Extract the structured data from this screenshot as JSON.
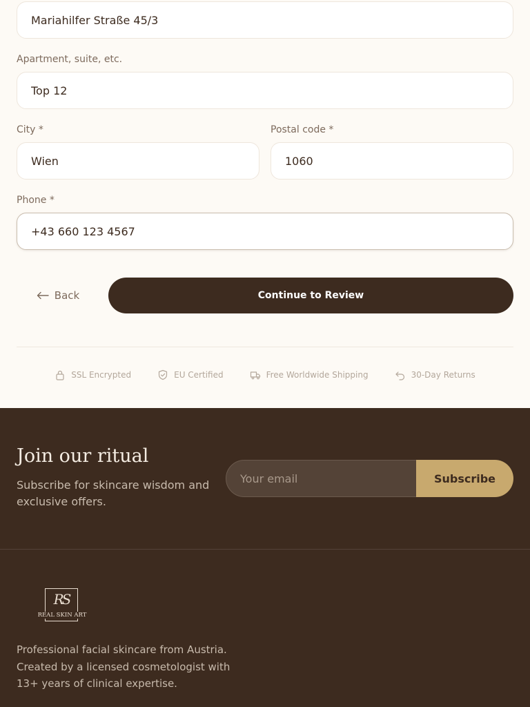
{
  "address": {
    "street_value": "Mariahilfer Straße 45/3",
    "apartment_label": "Apartment, suite, etc.",
    "apartment_value": "Top 12",
    "city_label": "City *",
    "city_value": "Wien",
    "postal_label": "Postal code *",
    "postal_value": "1060",
    "phone_label": "Phone *",
    "phone_value": "+43 660 123 4567"
  },
  "actions": {
    "back_label": "Back",
    "continue_label": "Continue to Review"
  },
  "trust": [
    {
      "label": "SSL Encrypted",
      "icon": "lock-icon"
    },
    {
      "label": "EU Certified",
      "icon": "shield-check-icon"
    },
    {
      "label": "Free Worldwide Shipping",
      "icon": "truck-icon"
    },
    {
      "label": "30-Day Returns",
      "icon": "return-arrow-icon"
    }
  ],
  "newsletter": {
    "title": "Join our ritual",
    "subtitle": "Subscribe for skincare wisdom and exclusive offers.",
    "email_placeholder": "Your email",
    "subscribe_label": "Subscribe"
  },
  "brand": {
    "logo_text": "REAL SKIN ART",
    "logo_monogram": "RS",
    "description": "Professional facial skincare from Austria. Created by a licensed cosmetologist with 13+ years of clinical expertise."
  },
  "colors": {
    "primary_dark": "#3d2b1f",
    "accent_gold": "#c8a96e",
    "background": "#fdfaf5"
  }
}
